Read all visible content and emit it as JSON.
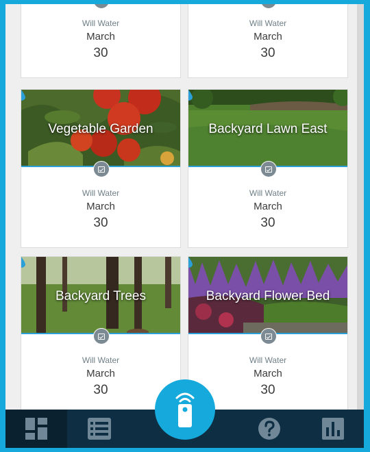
{
  "colors": {
    "accent": "#16a9dc",
    "tabbar": "#0e2f43",
    "icon": "#6f8797"
  },
  "zones": [
    {
      "name": "",
      "will_water": "Will Water",
      "month": "March",
      "day": "30",
      "partial": true
    },
    {
      "name": "",
      "will_water": "Will Water",
      "month": "March",
      "day": "30",
      "partial": true
    },
    {
      "name": "Vegetable Garden",
      "image": "tomato-plant",
      "will_water": "Will Water",
      "month": "March",
      "day": "30"
    },
    {
      "name": "Backyard Lawn East",
      "image": "lawn",
      "will_water": "Will Water",
      "month": "March",
      "day": "30"
    },
    {
      "name": "Backyard Trees",
      "image": "trees",
      "will_water": "Will Water",
      "month": "March",
      "day": "30"
    },
    {
      "name": "Backyard Flower Bed",
      "image": "flower-bed",
      "will_water": "Will Water",
      "month": "March",
      "day": "30"
    }
  ],
  "tabbar": {
    "tabs": [
      {
        "icon": "dashboard-icon",
        "active": true
      },
      {
        "icon": "list-icon",
        "active": false
      },
      {
        "icon": "remote-icon",
        "active": false
      },
      {
        "icon": "help-icon",
        "active": false
      },
      {
        "icon": "chart-icon",
        "active": false
      }
    ]
  }
}
